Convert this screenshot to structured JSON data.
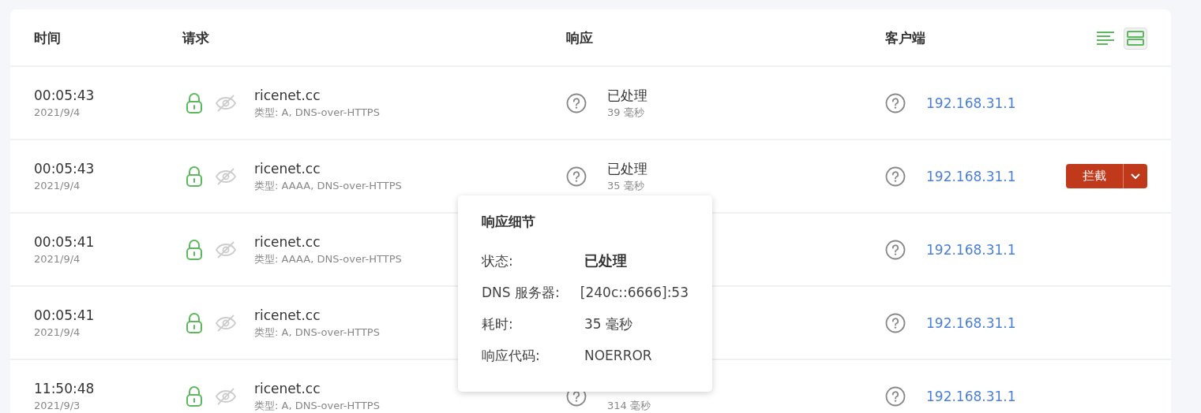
{
  "columns": [
    {
      "label": "时间"
    },
    {
      "label": "请求"
    },
    {
      "label": "响应"
    },
    {
      "label": "客户端"
    }
  ],
  "view_buttons": [
    {
      "kind": "compact",
      "selected": false
    },
    {
      "kind": "expanded",
      "selected": true
    }
  ],
  "rows": [
    {
      "time": "00:05:43",
      "date": "2021/9/4",
      "domain": "ricenet.cc",
      "type": "类型: A, DNS-over-HTTPS",
      "response": {
        "status": "已处理",
        "elapsed": "39 毫秒"
      },
      "client": "192.168.31.1"
    },
    {
      "time": "00:05:43",
      "date": "2021/9/4",
      "domain": "ricenet.cc",
      "type": "类型: AAAA, DNS-over-HTTPS",
      "response": {
        "status": "已处理",
        "elapsed": "35 毫秒"
      },
      "client": "192.168.31.1",
      "actions": {
        "block": "拦截"
      }
    },
    {
      "time": "00:05:41",
      "date": "2021/9/4",
      "domain": "ricenet.cc",
      "type": "类型: AAAA, DNS-over-HTTPS",
      "client": "192.168.31.1"
    },
    {
      "time": "00:05:41",
      "date": "2021/9/4",
      "domain": "ricenet.cc",
      "type": "类型: A, DNS-over-HTTPS",
      "client": "192.168.31.1"
    },
    {
      "time": "11:50:48",
      "date": "2021/9/3",
      "domain": "ricenet.cc",
      "type": "类型: A, DNS-over-HTTPS",
      "response": {
        "elapsed": "314 毫秒"
      },
      "client": "192.168.31.1"
    }
  ],
  "tooltip": {
    "title": "响应细节",
    "fields": [
      {
        "label": "状态:",
        "value": "已处理",
        "kind": "status"
      },
      {
        "label": "DNS 服务器:",
        "value": "[240c::6666]:53",
        "kind": "text"
      },
      {
        "label": "耗时:",
        "value": "35 毫秒",
        "kind": "text"
      },
      {
        "label": "响应代码:",
        "value": "NOERROR",
        "kind": "text"
      }
    ]
  }
}
